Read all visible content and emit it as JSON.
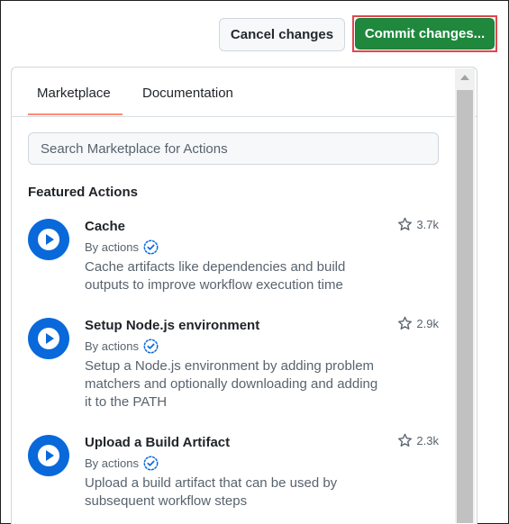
{
  "toolbar": {
    "cancel_label": "Cancel changes",
    "commit_label": "Commit changes..."
  },
  "tabs": [
    {
      "label": "Marketplace",
      "active": true
    },
    {
      "label": "Documentation",
      "active": false
    }
  ],
  "search": {
    "placeholder": "Search Marketplace for Actions"
  },
  "featured_heading": "Featured Actions",
  "actions": [
    {
      "title": "Cache",
      "by": "By actions",
      "stars": "3.7k",
      "description": "Cache artifacts like dependencies and build outputs to improve workflow execution time",
      "icon": "play-icon"
    },
    {
      "title": "Setup Node.js environment",
      "by": "By actions",
      "stars": "2.9k",
      "description": "Setup a Node.js environment by adding problem matchers and optionally downloading and adding it to the PATH",
      "icon": "play-icon"
    },
    {
      "title": "Upload a Build Artifact",
      "by": "By actions",
      "stars": "2.3k",
      "description": "Upload a build artifact that can be used by subsequent workflow steps",
      "icon": "play-icon"
    }
  ],
  "colors": {
    "accent": "#0969da",
    "commit_green": "#1f883d",
    "tab_underline": "#fd8c73",
    "highlight_border": "#e0474c"
  }
}
